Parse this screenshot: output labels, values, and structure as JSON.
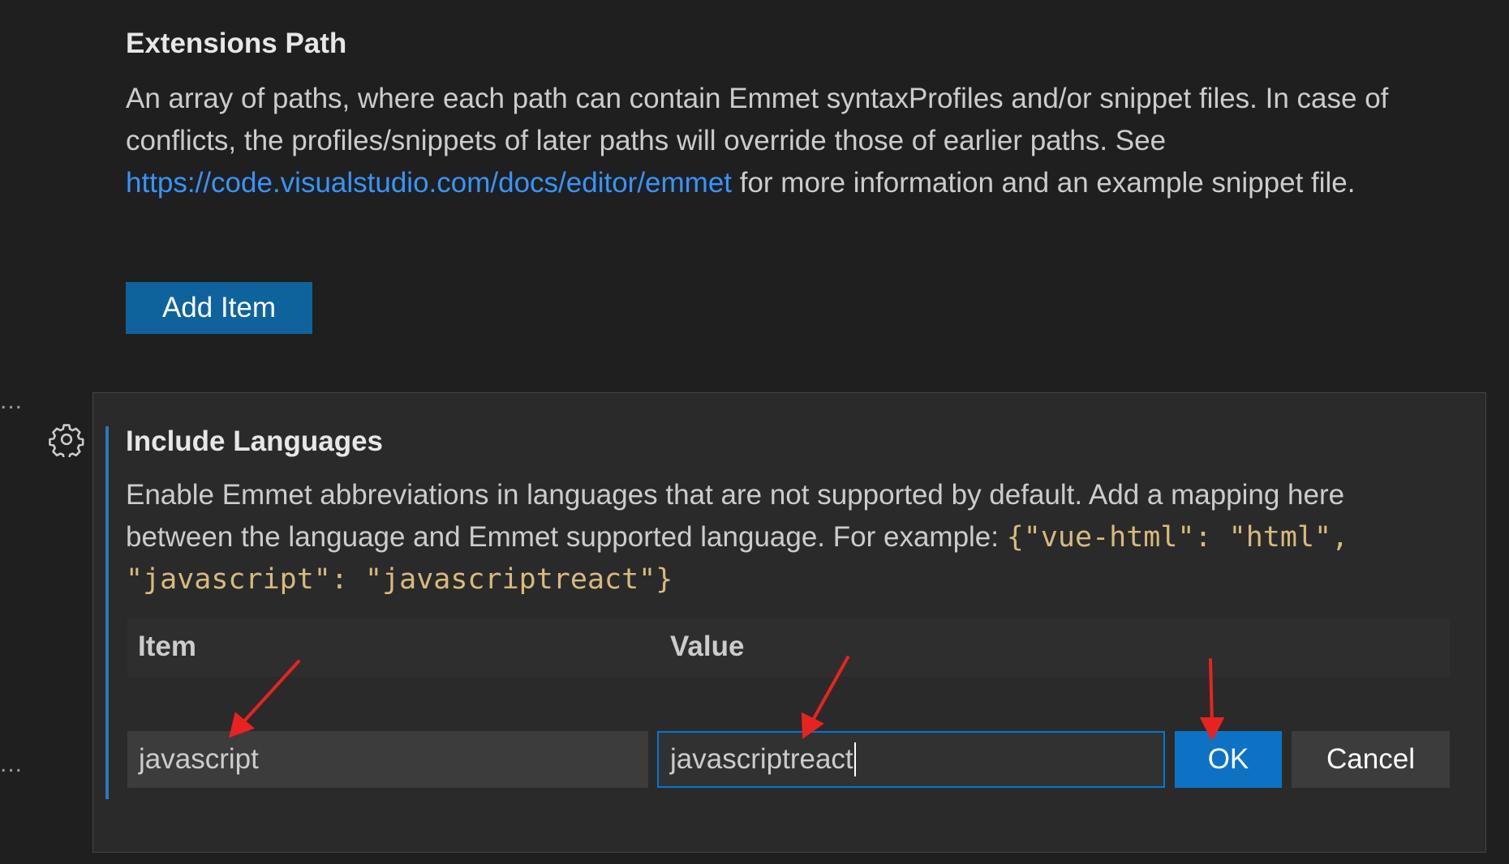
{
  "extensions_path": {
    "title": "Extensions Path",
    "desc_part1": "An array of paths, where each path can contain Emmet syntaxProfiles and/or snippet files. In case of conflicts, the profiles/snippets of later paths will override those of earlier paths. See ",
    "link": "https://code.visualstudio.com/docs/editor/emmet",
    "desc_part2": " for more information and an example snippet file.",
    "add_item_label": "Add Item"
  },
  "gutter": {
    "dots_top": "...",
    "dots_bottom": "..."
  },
  "include_languages": {
    "title": "Include Languages",
    "desc_text": "Enable Emmet abbreviations in languages that are not supported by default. Add a mapping here between the language and Emmet supported language. For example: ",
    "desc_code": "{\"vue-html\": \"html\", \"javascript\": \"javascriptreact\"}",
    "table": {
      "col_item": "Item",
      "col_value": "Value"
    },
    "item_input_value": "javascript",
    "value_input_value": "javascriptreact",
    "ok_label": "OK",
    "cancel_label": "Cancel"
  },
  "colors": {
    "background": "#1f1f1f",
    "link": "#3794ff",
    "primary_button": "#0e639c",
    "code": "#d7ba7d",
    "annotation_arrow": "#e8231f"
  },
  "icons": {
    "settings": "gear-icon"
  }
}
